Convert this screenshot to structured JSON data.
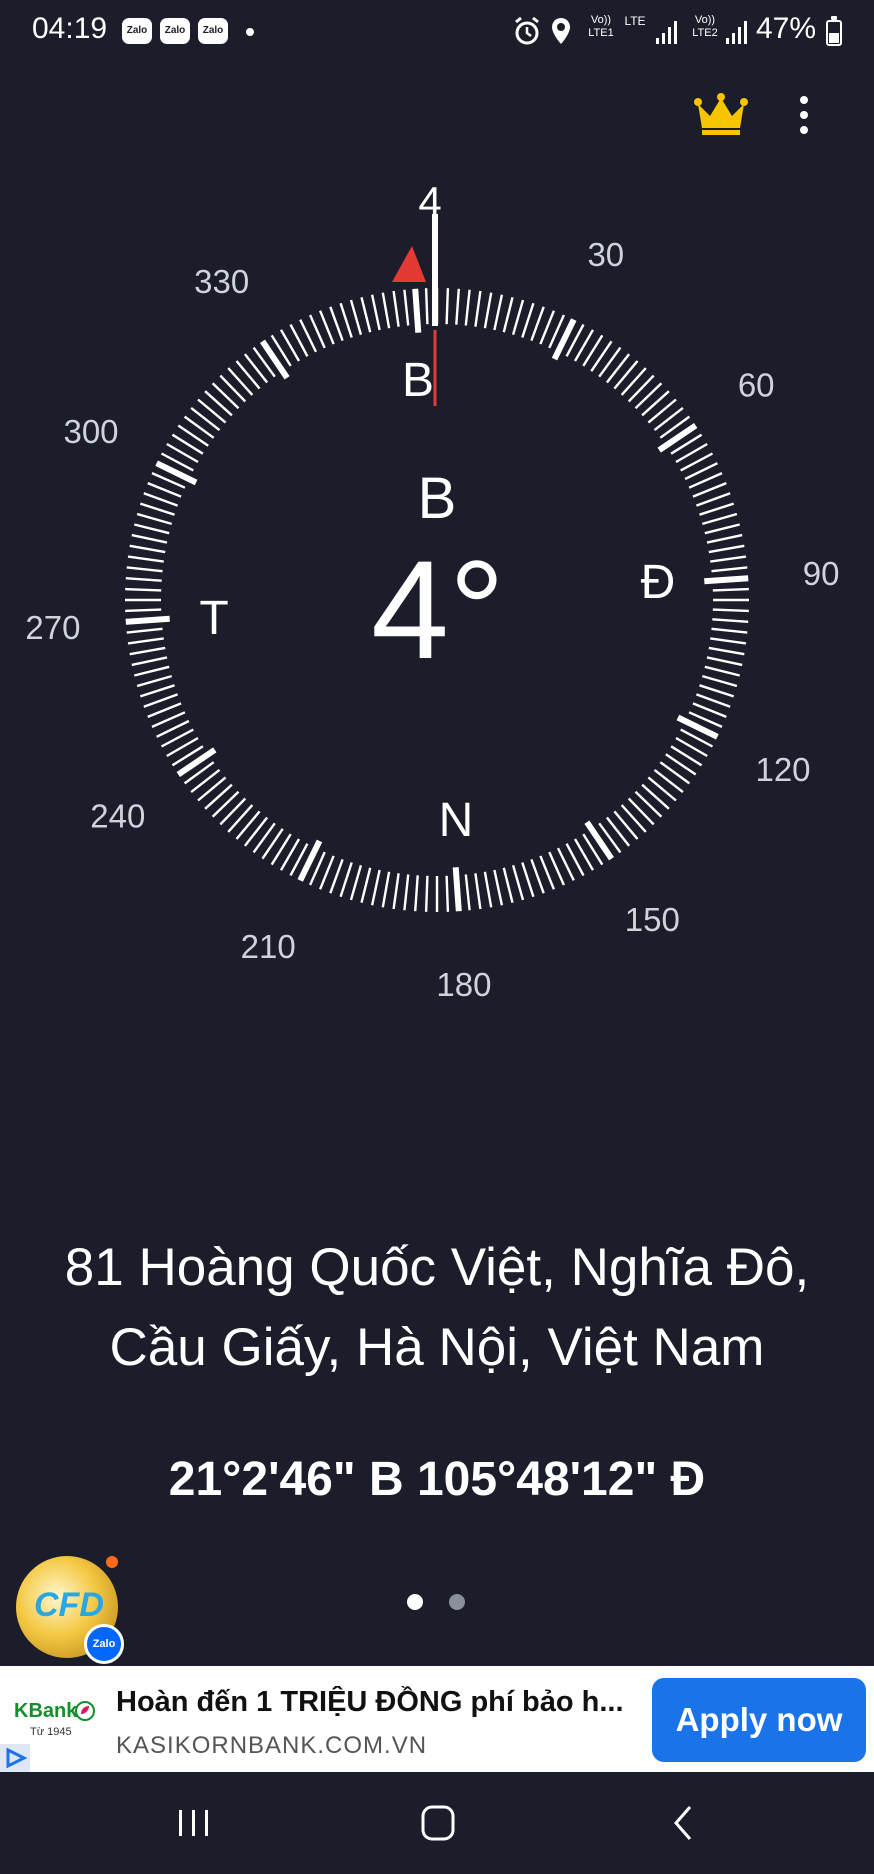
{
  "status_bar": {
    "time": "04:19",
    "notification_apps": [
      "Zalo",
      "Zalo",
      "Zalo"
    ],
    "network_1": "Vo)) LTE1",
    "network_lte": "LTE",
    "network_2": "Vo)) LTE2",
    "battery_percent": "47%",
    "battery_level": 0.47
  },
  "compass": {
    "heading_value": "4°",
    "heading_direction": "B",
    "top_heading_label": "4",
    "cardinal": {
      "north": "B",
      "east": "Đ",
      "south": "N",
      "west": "T"
    },
    "degree_labels": [
      "30",
      "60",
      "90",
      "120",
      "150",
      "180",
      "210",
      "240",
      "270",
      "300",
      "330"
    ],
    "heading_degrees": 4
  },
  "location": {
    "address": "81 Hoàng Quốc Việt, Nghĩa Đô, Cầu Giấy, Hà Nội, Việt Nam",
    "coordinates": "21°2'46\" B  105°48'12\" Đ"
  },
  "pager": {
    "count": 2,
    "active_index": 0
  },
  "floating_bubble": {
    "label": "Zalo",
    "text": "CFD"
  },
  "ad": {
    "brand": "KBank",
    "brand_sub": "Từ 1945",
    "title": "Hoàn đến 1 TRIỆU ĐỒNG phí bảo h...",
    "url": "KASIKORNBANK.COM.VN",
    "cta": "Apply now"
  },
  "colors": {
    "background": "#1b1e2a",
    "needle_red": "#e53935",
    "crown": "#f6c500",
    "ad_button": "#1a73e8"
  },
  "icons": {
    "alarm": "alarm-icon",
    "location": "location-pin-icon",
    "signal": "signal-icon",
    "crown": "crown-icon",
    "menu": "more-vertical-icon",
    "nav_recent": "recent-apps-icon",
    "nav_home": "home-icon",
    "nav_back": "back-icon"
  }
}
